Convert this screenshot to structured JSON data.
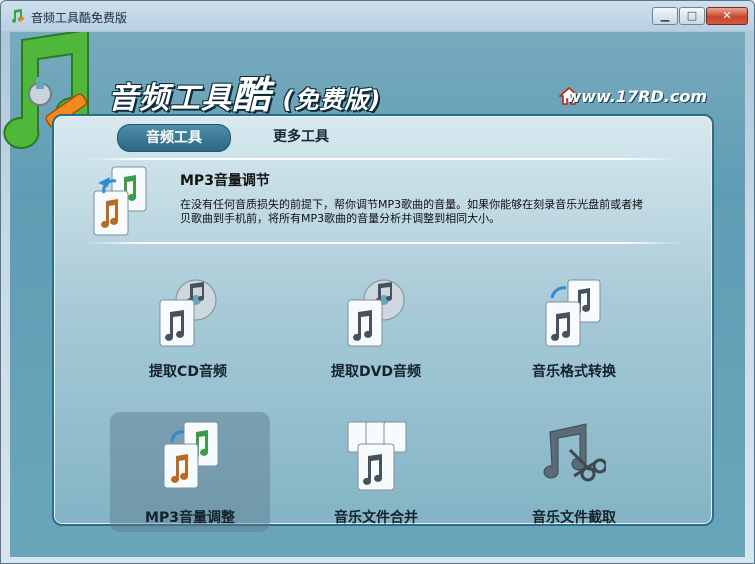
{
  "window": {
    "title": "音频工具酷免费版"
  },
  "header": {
    "brand_main": "音频工具",
    "brand_big": "酷",
    "brand_sub": "(免费版)",
    "site": "www.17RD.com"
  },
  "tabs": [
    {
      "label": "音频工具",
      "active": true
    },
    {
      "label": "更多工具",
      "active": false
    }
  ],
  "description": {
    "title": "MP3音量调节",
    "text": "在没有任何音质损失的前提下，帮你调节MP3歌曲的音量。如果你能够在刻录音乐光盘前或者拷贝歌曲到手机前，将所有MP3歌曲的音量分析并调整到相同大小。"
  },
  "tools": [
    {
      "label": "提取CD音频",
      "icon": "cd-music-icon"
    },
    {
      "label": "提取DVD音频",
      "icon": "dvd-music-icon"
    },
    {
      "label": "音乐格式转换",
      "icon": "format-convert-icon"
    },
    {
      "label": "MP3音量调整",
      "icon": "volume-adjust-icon",
      "selected": true
    },
    {
      "label": "音乐文件合并",
      "icon": "merge-files-icon"
    },
    {
      "label": "音乐文件截取",
      "icon": "cut-music-icon"
    }
  ],
  "colors": {
    "accent": "#2c6883",
    "panel_border": "#2e6c86",
    "close_button": "#c8462e"
  }
}
